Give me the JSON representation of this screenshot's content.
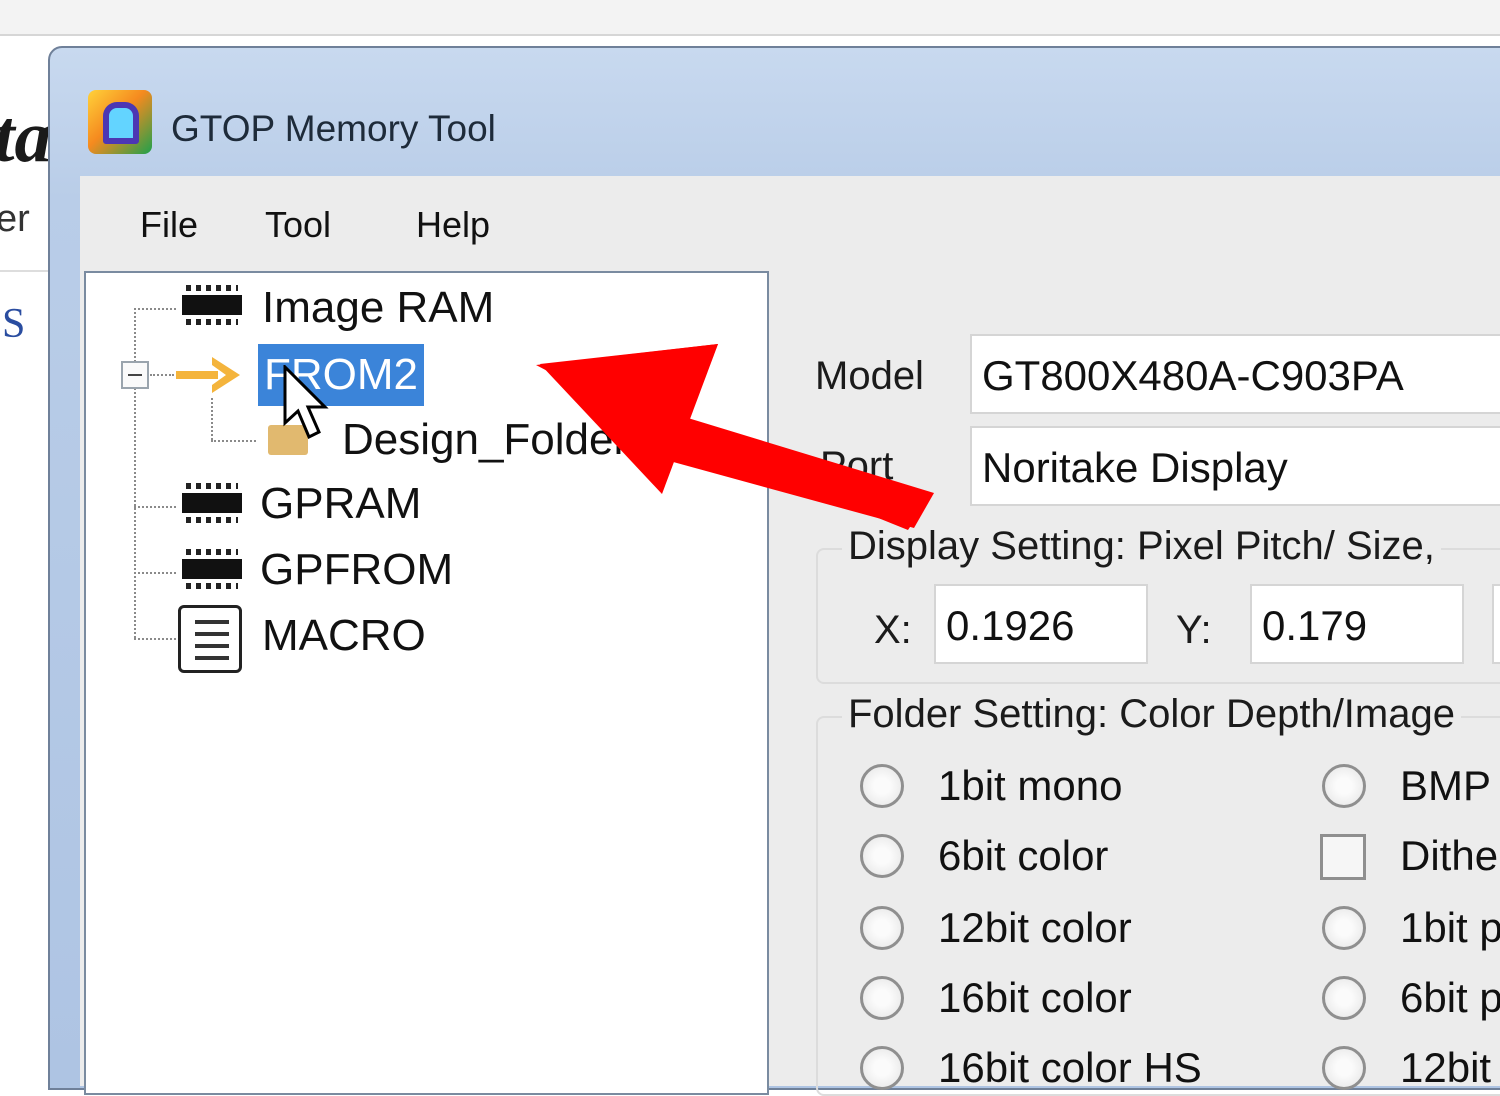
{
  "window": {
    "title": "GTOP Memory Tool"
  },
  "menu": [
    {
      "label": "File"
    },
    {
      "label": "Tool"
    },
    {
      "label": "Help"
    }
  ],
  "tree": {
    "image_ram": "Image RAM",
    "from2": "FROM2",
    "design_folder": "Design_Folder",
    "gpram": "GPRAM",
    "gpfrom": "GPFROM",
    "macro": "MACRO"
  },
  "model": {
    "label": "Model",
    "value": "GT800X480A-C903PA"
  },
  "port": {
    "label": "Port",
    "value": "Noritake Display"
  },
  "display_setting": {
    "title": "Display Setting: Pixel Pitch/ Size,",
    "x_label": "X:",
    "x_value": "0.1926",
    "y_label": "Y:",
    "y_value": "0.179"
  },
  "folder_setting": {
    "title": "Folder Setting: Color Depth/Image",
    "left_options": [
      "1bit mono",
      "6bit color",
      "12bit color",
      "16bit color",
      "16bit color HS"
    ],
    "right_options": [
      "BMP",
      "Dither",
      "1bit p",
      "6bit p",
      "12bit"
    ]
  },
  "background": {
    "letters": "ta",
    "tab": "er",
    "link": "S"
  },
  "colors": {
    "selection": "#3b84d9",
    "annotation_arrow": "#ff0000",
    "tree_arrow": "#f4b43c"
  }
}
